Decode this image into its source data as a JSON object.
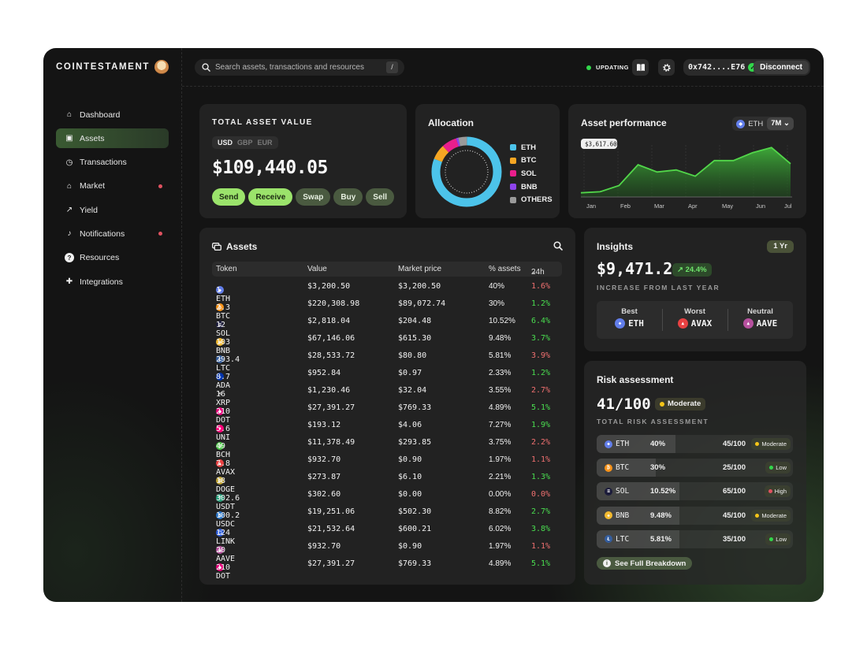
{
  "brand": "COINTESTAMENT",
  "sidebar": {
    "items": [
      {
        "label": "Dashboard",
        "icon": "home-icon",
        "active": false,
        "dot": false
      },
      {
        "label": "Assets",
        "icon": "assets-icon",
        "active": true,
        "dot": false
      },
      {
        "label": "Transactions",
        "icon": "clock-icon",
        "active": false,
        "dot": false
      },
      {
        "label": "Market",
        "icon": "bank-icon",
        "active": false,
        "dot": true
      },
      {
        "label": "Yield",
        "icon": "trend-up-icon",
        "active": false,
        "dot": false
      },
      {
        "label": "Notifications",
        "icon": "bell-icon",
        "active": false,
        "dot": true
      },
      {
        "label": "Resources",
        "icon": "help-icon",
        "active": false,
        "dot": false
      },
      {
        "label": "Integrations",
        "icon": "puzzle-icon",
        "active": false,
        "dot": false
      }
    ]
  },
  "topbar": {
    "search_placeholder": "Search assets, transactions and resources",
    "shortcut": "/",
    "status": "UPDATING",
    "address": "0x742....E76",
    "disconnect_label": "Disconnect"
  },
  "total": {
    "title": "TOTAL ASSET VALUE",
    "currencies": [
      "USD",
      "GBP",
      "EUR"
    ],
    "selected_currency": "USD",
    "value": "$109,440.05",
    "actions": [
      {
        "label": "Send",
        "style": "primary"
      },
      {
        "label": "Receive",
        "style": "primary"
      },
      {
        "label": "Swap",
        "style": "secondary"
      },
      {
        "label": "Buy",
        "style": "secondary"
      },
      {
        "label": "Sell",
        "style": "secondary"
      }
    ]
  },
  "allocation": {
    "title": "Allocation",
    "legend": [
      {
        "label": "ETH",
        "color": "#4cc3ea"
      },
      {
        "label": "BTC",
        "color": "#f5a623"
      },
      {
        "label": "SOL",
        "color": "#e91e8c"
      },
      {
        "label": "BNB",
        "color": "#8e44ec"
      },
      {
        "label": "OTHERS",
        "color": "#9a9a9a"
      }
    ],
    "chart_data": {
      "type": "pie",
      "categories": [
        "ETH",
        "BTC",
        "SOL",
        "BNB",
        "OTHERS"
      ],
      "values": [
        81,
        7,
        7,
        1,
        4
      ]
    }
  },
  "performance": {
    "title": "Asset performance",
    "token": "ETH",
    "range": "7M",
    "tooltip": "$3,617.60",
    "chart_data": {
      "type": "area",
      "x": [
        "Jan",
        "Feb",
        "Mar",
        "Apr",
        "May",
        "Jun",
        "Jul"
      ],
      "series": [
        {
          "values": [
            0.08,
            0.1,
            0.22,
            0.62,
            0.48,
            0.52,
            0.4,
            0.7,
            0.7,
            0.85,
            0.95,
            0.64
          ]
        }
      ],
      "xticks": [
        "Jan",
        "Feb",
        "Mar",
        "Apr",
        "May",
        "Jun",
        "Jul"
      ],
      "grid": true
    }
  },
  "assets": {
    "title": "Assets",
    "columns": [
      "Token",
      "Value",
      "Market price",
      "% assets",
      "24h"
    ],
    "rows": [
      {
        "token": "1 ETH",
        "icon_color": "#627eea",
        "value": "$3,200.50",
        "market": "$3,200.50",
        "pct": "40%",
        "change": "1.6%",
        "dir": "neg"
      },
      {
        "token": "2.3 BTC",
        "icon_color": "#f7931a",
        "value": "$220,308.98",
        "market": "$89,072.74",
        "pct": "30%",
        "change": "1.2%",
        "dir": "pos"
      },
      {
        "token": "12 SOL",
        "icon_color": "#1b1b3a",
        "value": "$2,818.04",
        "market": "$204.48",
        "pct": "10.52%",
        "change": "6.4%",
        "dir": "pos"
      },
      {
        "token": "103 BNB",
        "icon_color": "#f3ba2f",
        "value": "$67,146.06",
        "market": "$615.30",
        "pct": "9.48%",
        "change": "3.7%",
        "dir": "pos"
      },
      {
        "token": "293.4 LTC",
        "icon_color": "#345d9d",
        "value": "$28,533.72",
        "market": "$80.80",
        "pct": "5.81%",
        "change": "3.9%",
        "dir": "neg"
      },
      {
        "token": "8.7 ADA",
        "icon_color": "#0033ad",
        "value": "$952.84",
        "market": "$0.97",
        "pct": "2.33%",
        "change": "1.2%",
        "dir": "pos"
      },
      {
        "token": "16 XRP",
        "icon_color": "#222222",
        "value": "$1,230.46",
        "market": "$32.04",
        "pct": "3.55%",
        "change": "2.7%",
        "dir": "neg"
      },
      {
        "token": "210 DOT",
        "icon_color": "#e6007a",
        "value": "$27,391.27",
        "market": "$769.33",
        "pct": "4.89%",
        "change": "5.1%",
        "dir": "pos"
      },
      {
        "token": "5.6 UNI",
        "icon_color": "#ff007a",
        "value": "$193.12",
        "market": "$4.06",
        "pct": "7.27%",
        "change": "1.9%",
        "dir": "pos"
      },
      {
        "token": "49 BCH",
        "icon_color": "#4cc947",
        "value": "$11,378.49",
        "market": "$293.85",
        "pct": "3.75%",
        "change": "2.2%",
        "dir": "neg"
      },
      {
        "token": "7.8 AVAX",
        "icon_color": "#e84142",
        "value": "$932.70",
        "market": "$0.90",
        "pct": "1.97%",
        "change": "1.1%",
        "dir": "neg"
      },
      {
        "token": "18 DOGE",
        "icon_color": "#c2a633",
        "value": "$273.87",
        "market": "$6.10",
        "pct": "2.21%",
        "change": "1.3%",
        "dir": "pos"
      },
      {
        "token": "302.6 USDT",
        "icon_color": "#26a17b",
        "value": "$302.60",
        "market": "$0.00",
        "pct": "0.00%",
        "change": "0.0%",
        "dir": "neg"
      },
      {
        "token": "100.2 USDC",
        "icon_color": "#2775ca",
        "value": "$19,251.06",
        "market": "$502.30",
        "pct": "8.82%",
        "change": "2.7%",
        "dir": "pos"
      },
      {
        "token": "124 LINK",
        "icon_color": "#2a5ada",
        "value": "$21,532.64",
        "market": "$600.21",
        "pct": "6.02%",
        "change": "3.8%",
        "dir": "pos"
      },
      {
        "token": "20 AAVE",
        "icon_color": "#b6509e",
        "value": "$932.70",
        "market": "$0.90",
        "pct": "1.97%",
        "change": "1.1%",
        "dir": "neg"
      },
      {
        "token": "210 DOT",
        "icon_color": "#e6007a",
        "value": "$27,391.27",
        "market": "$769.33",
        "pct": "4.89%",
        "change": "5.1%",
        "dir": "pos"
      }
    ]
  },
  "insights": {
    "title": "Insights",
    "period": "1 Yr",
    "value": "$9,471.2",
    "change": "24.4%",
    "caption": "INCREASE FROM LAST YEAR",
    "best": {
      "label": "Best",
      "token": "ETH",
      "icon_color": "#627eea"
    },
    "worst": {
      "label": "Worst",
      "token": "AVAX",
      "icon_color": "#e84142"
    },
    "neutral": {
      "label": "Neutral",
      "token": "AAVE",
      "icon_color": "#b6509e"
    }
  },
  "risk": {
    "title": "Risk assessment",
    "score": "41/100",
    "level": "Moderate",
    "caption": "TOTAL RISK ASSESSMENT",
    "rows": [
      {
        "token": "ETH",
        "icon_color": "#627eea",
        "pct": "40%",
        "fill": 0.4,
        "score": "45/100",
        "level": "Moderate",
        "level_color": "#f5c518"
      },
      {
        "token": "BTC",
        "icon_color": "#f7931a",
        "pct": "30%",
        "fill": 0.3,
        "score": "25/100",
        "level": "Low",
        "level_color": "#32d74b"
      },
      {
        "token": "SOL",
        "icon_color": "#1b1b3a",
        "pct": "10.52%",
        "fill": 0.42,
        "score": "65/100",
        "level": "High",
        "level_color": "#e05260"
      },
      {
        "token": "BNB",
        "icon_color": "#f3ba2f",
        "pct": "9.48%",
        "fill": 0.42,
        "score": "45/100",
        "level": "Moderate",
        "level_color": "#f5c518"
      },
      {
        "token": "LTC",
        "icon_color": "#345d9d",
        "pct": "5.81%",
        "fill": 0.42,
        "score": "35/100",
        "level": "Low",
        "level_color": "#32d74b"
      }
    ],
    "breakdown_label": "See Full Breakdown"
  }
}
